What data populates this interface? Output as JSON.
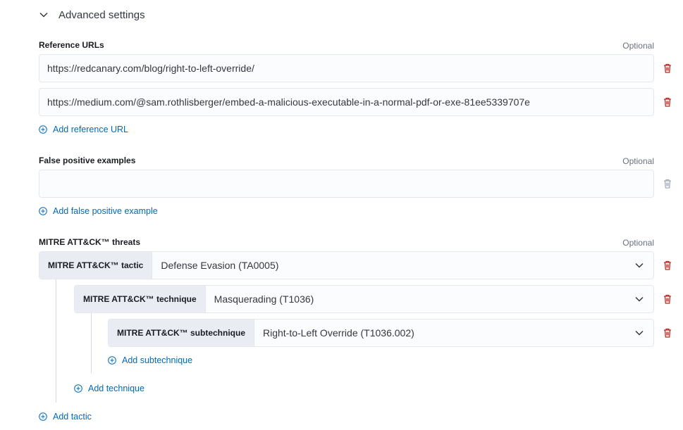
{
  "accordion": {
    "label": "Advanced settings"
  },
  "reference_urls": {
    "label": "Reference URLs",
    "optional": "Optional",
    "values": [
      "https://redcanary.com/blog/right-to-left-override/",
      "https://medium.com/@sam.rothlisberger/embed-a-malicious-executable-in-a-normal-pdf-or-exe-81ee5339707e"
    ],
    "add_label": "Add reference URL"
  },
  "false_positives": {
    "label": "False positive examples",
    "optional": "Optional",
    "value": "",
    "add_label": "Add false positive example"
  },
  "mitre": {
    "label": "MITRE ATT&CK™ threats",
    "optional": "Optional",
    "tactic": {
      "prepend": "MITRE ATT&CK™ tactic",
      "value": "Defense Evasion (TA0005)"
    },
    "technique": {
      "prepend": "MITRE ATT&CK™ technique",
      "value": "Masquerading (T1036)"
    },
    "subtechnique": {
      "prepend": "MITRE ATT&CK™ subtechnique",
      "value": "Right-to-Left Override (T1036.002)"
    },
    "add_subtechnique": "Add subtechnique",
    "add_technique": "Add technique",
    "add_tactic": "Add tactic"
  },
  "colors": {
    "link": "#006bb8",
    "danger": "#bd271e",
    "disabled": "#a2abba"
  },
  "icons": {
    "accordion": "chevron-down-icon",
    "remove": "trash-icon",
    "add": "plus-in-circle-icon",
    "select": "chevron-down-icon"
  }
}
